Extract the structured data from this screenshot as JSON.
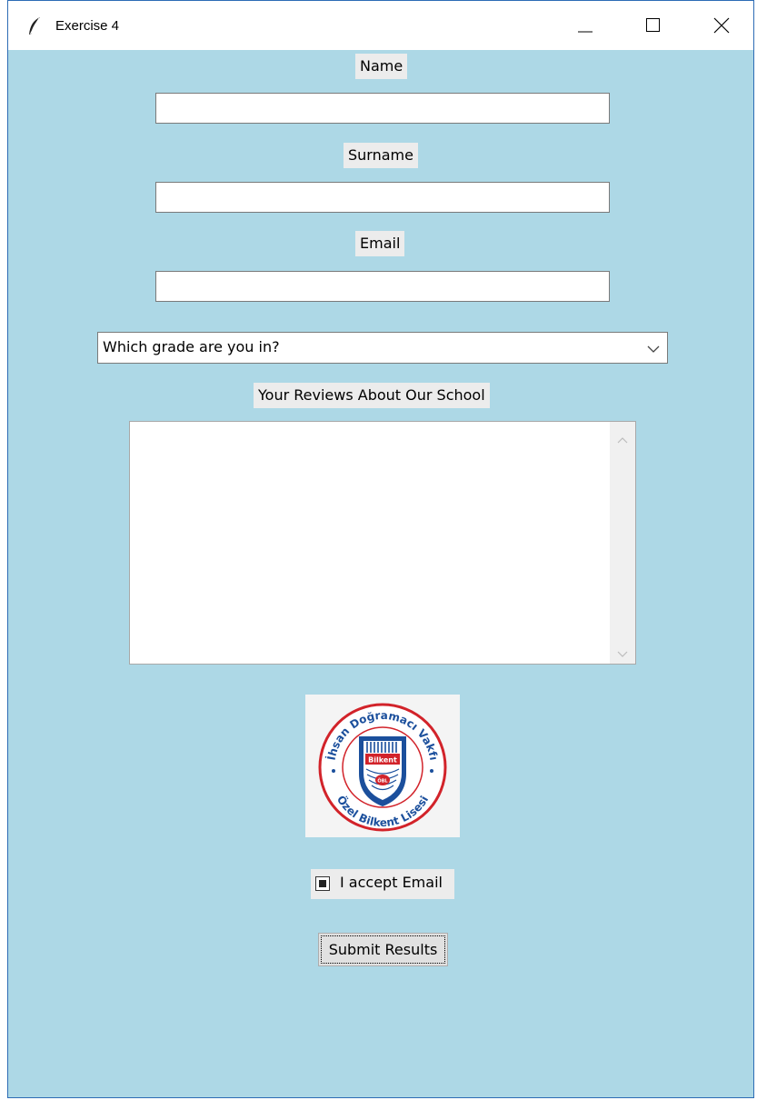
{
  "window": {
    "title": "Exercise 4",
    "controls": {
      "minimize": "minimize-icon",
      "maximize": "maximize-icon",
      "close": "close-icon"
    }
  },
  "form": {
    "name_label": "Name",
    "name_value": "",
    "surname_label": "Surname",
    "surname_value": "",
    "email_label": "Email",
    "email_value": "",
    "grade_select": "Which grade are you in?",
    "reviews_label": "Your Reviews About Our School",
    "reviews_value": "",
    "logo": {
      "top_text": "İhsan Doğramacı Vakfı",
      "bottom_text": "Özel Bilkent Lisesi",
      "shield_text": "Bilkent",
      "shield_badge": "ÖBL"
    },
    "accept_email_label": "I accept Email",
    "accept_email_checked": true,
    "submit_label": "Submit Results"
  },
  "colors": {
    "background": "#add8e6",
    "label_bg": "#ececec",
    "logo_red": "#d2232a",
    "logo_blue": "#1b4f9c"
  }
}
